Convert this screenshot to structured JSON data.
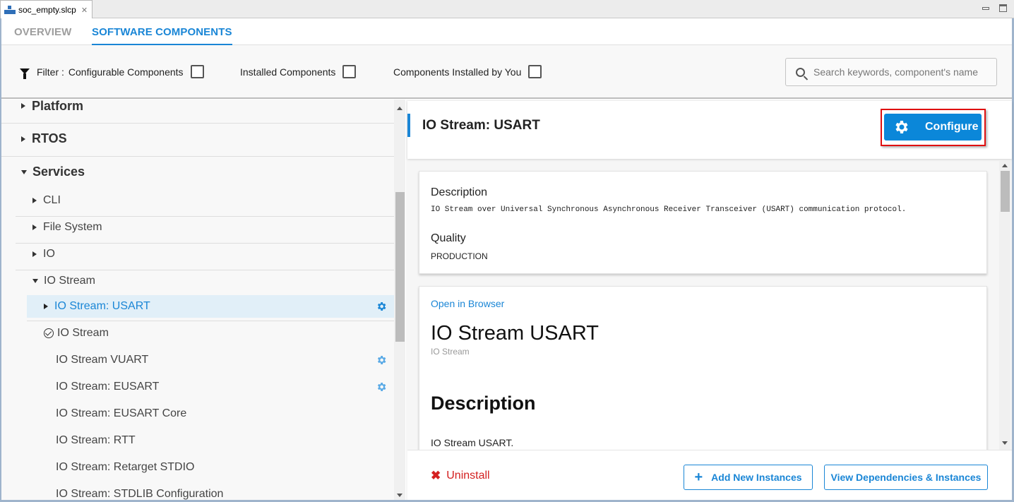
{
  "editor_tab": {
    "filename": "soc_empty.slcp",
    "close_glyph": "✕",
    "icon": "components-icon"
  },
  "window_controls": {
    "minimize": "minimize-icon",
    "maximize": "maximize-icon"
  },
  "page_tabs": [
    {
      "label": "OVERVIEW",
      "active": false
    },
    {
      "label": "SOFTWARE COMPONENTS",
      "active": true
    }
  ],
  "filter": {
    "prefix": "Filter :",
    "options": [
      {
        "label": "Configurable Components",
        "checked": false
      },
      {
        "label": "Installed Components",
        "checked": false
      },
      {
        "label": "Components Installed by You",
        "checked": false
      }
    ],
    "search_placeholder": "Search keywords, component's name",
    "search_value": ""
  },
  "tree": {
    "items": [
      {
        "label": "Platform",
        "level": 0,
        "state": "collapsed"
      },
      {
        "label": "RTOS",
        "level": 0,
        "state": "collapsed"
      },
      {
        "label": "Services",
        "level": 0,
        "state": "expanded"
      },
      {
        "label": "CLI",
        "level": 1,
        "state": "collapsed"
      },
      {
        "label": "File System",
        "level": 1,
        "state": "collapsed"
      },
      {
        "label": "IO",
        "level": 1,
        "state": "collapsed"
      },
      {
        "label": "IO Stream",
        "level": 1,
        "state": "expanded"
      },
      {
        "label": "IO Stream: USART",
        "level": 2,
        "state": "collapsed",
        "selected": true,
        "configurable": true
      },
      {
        "label": "IO Stream",
        "level": 2,
        "installed": true
      },
      {
        "label": "IO Stream VUART",
        "level": 3,
        "configurable": true
      },
      {
        "label": "IO Stream: EUSART",
        "level": 3,
        "configurable": true
      },
      {
        "label": "IO Stream: EUSART Core",
        "level": 3
      },
      {
        "label": "IO Stream: RTT",
        "level": 3
      },
      {
        "label": "IO Stream: Retarget STDIO",
        "level": 3
      },
      {
        "label": "IO Stream: STDLIB Configuration",
        "level": 3
      }
    ]
  },
  "detail": {
    "title": "IO Stream: USART",
    "configure_label": "Configure",
    "summary": {
      "description_label": "Description",
      "description_text": "IO Stream over Universal Synchronous Asynchronous Receiver Transceiver (USART) communication protocol.",
      "quality_label": "Quality",
      "quality_value": "PRODUCTION"
    },
    "doc": {
      "open_link": "Open in Browser",
      "heading": "IO Stream USART",
      "category": "IO Stream",
      "section_heading": "Description",
      "section_text": "IO Stream USART."
    },
    "footer": {
      "uninstall_label": "Uninstall",
      "uninstall_glyph": "✖",
      "add_label": "Add New Instances",
      "add_glyph": "+",
      "view_label": "View Dependencies & Instances"
    }
  },
  "colors": {
    "accent": "#1a86d6",
    "configure_button": "#0b87d9",
    "highlight_box": "#e01010",
    "danger": "#d42020",
    "selected_row": "#e1eff8"
  }
}
